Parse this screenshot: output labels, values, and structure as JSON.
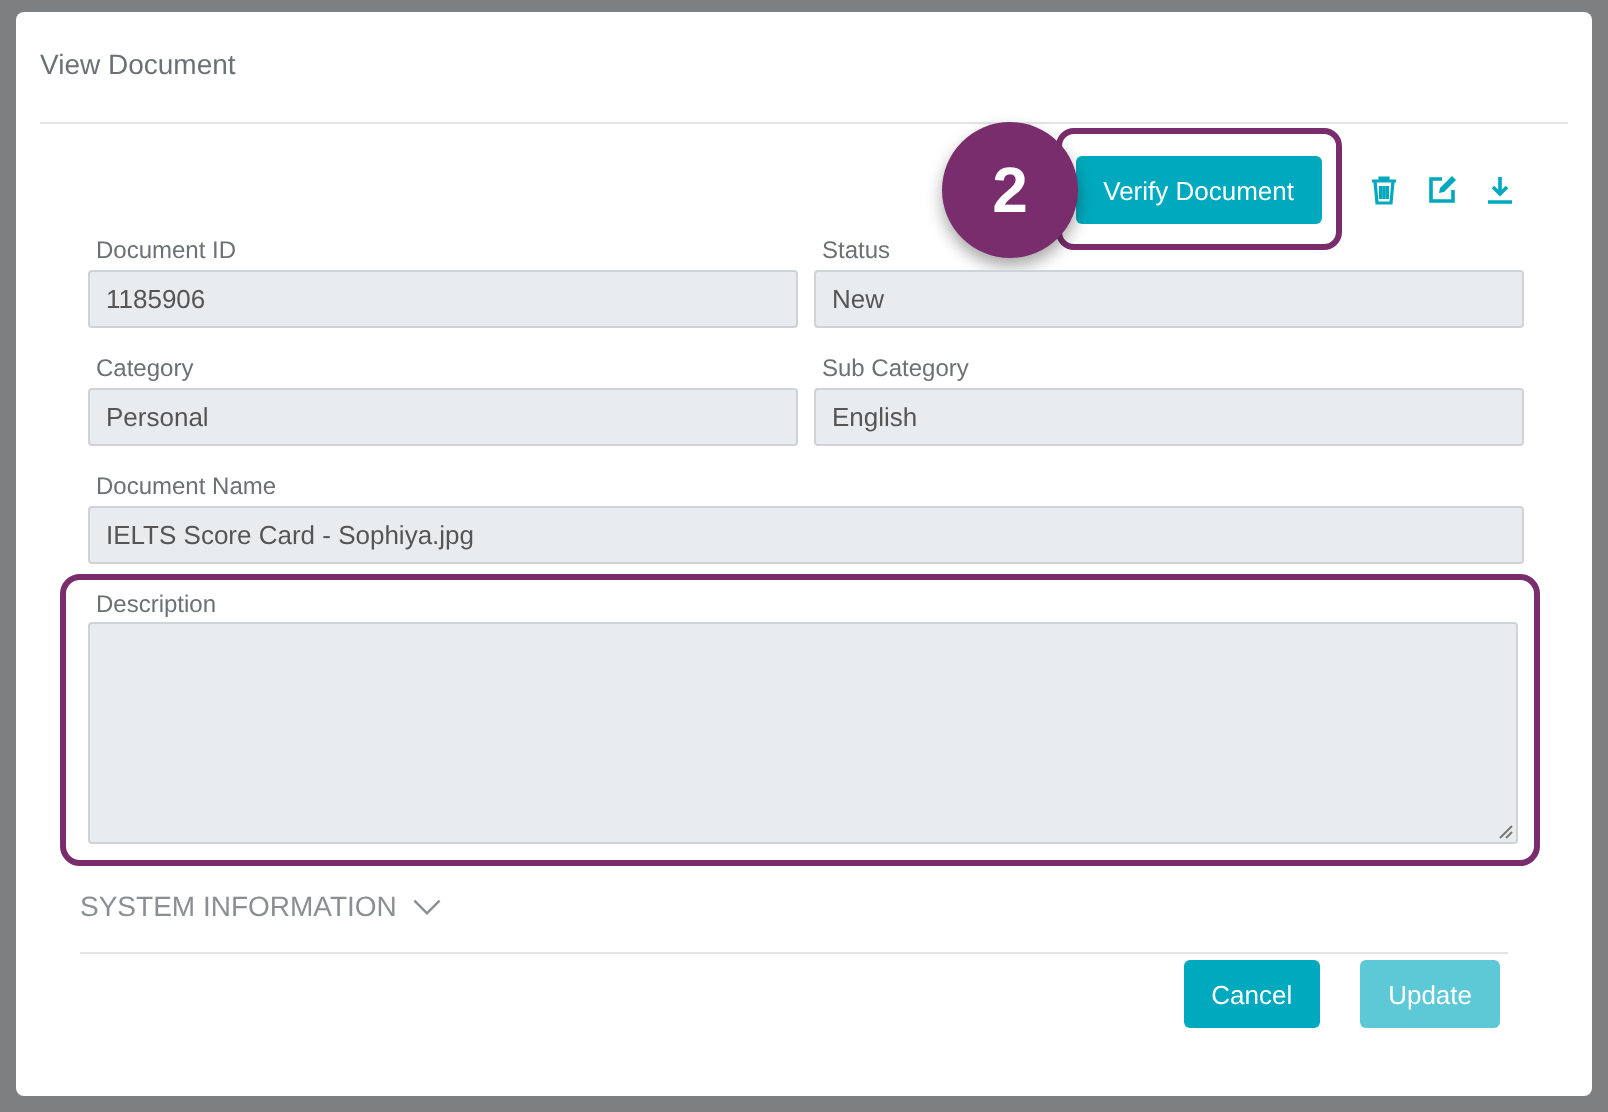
{
  "dialog": {
    "title": "View Document"
  },
  "toolbar": {
    "step_badge": "2",
    "verify_button": "Verify Document"
  },
  "fields": [
    {
      "label": "Document ID",
      "value": "1185906"
    },
    {
      "label": "Status",
      "value": "New"
    },
    {
      "label": "Category",
      "value": "Personal"
    },
    {
      "label": "Sub Category",
      "value": "English"
    },
    {
      "label": "Document Name",
      "value": "IELTS Score Card - Sophiya.jpg"
    }
  ],
  "description": {
    "label": "Description"
  },
  "system_information": {
    "label": "SYSTEM INFORMATION",
    "expanded": false
  },
  "buttons": [
    {
      "label": "Cancel",
      "disabled": false
    },
    {
      "label": "Update",
      "disabled": true
    }
  ]
}
